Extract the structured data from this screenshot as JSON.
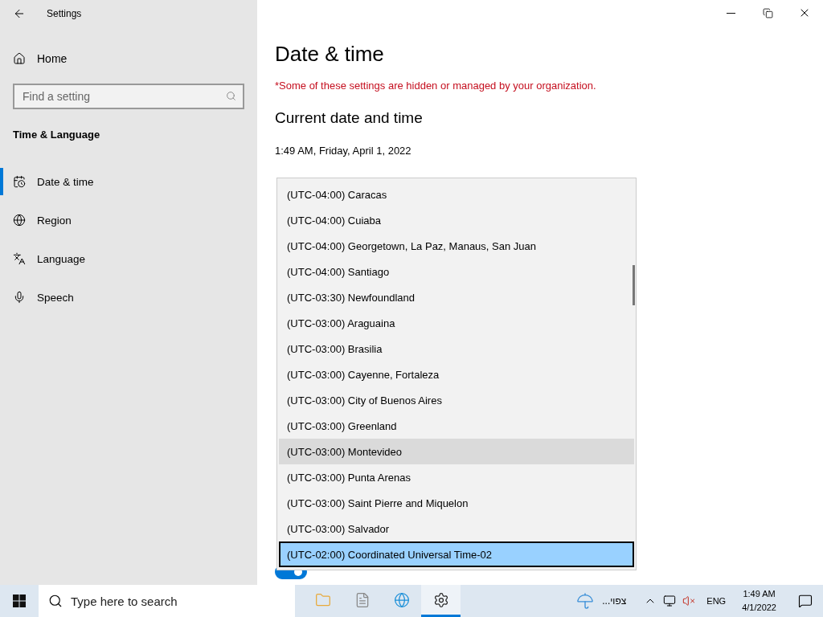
{
  "window": {
    "title": "Settings"
  },
  "sidebar": {
    "home": "Home",
    "search": {
      "placeholder": "Find a setting"
    },
    "section": "Time & Language",
    "items": [
      {
        "label": "Date & time",
        "selected": true,
        "kind": "calendar"
      },
      {
        "label": "Region",
        "selected": false,
        "kind": "globe"
      },
      {
        "label": "Language",
        "selected": false,
        "kind": "language"
      },
      {
        "label": "Speech",
        "selected": false,
        "kind": "mic"
      }
    ]
  },
  "page": {
    "title": "Date & time",
    "notice": "*Some of these settings are hidden or managed by your organization.",
    "heading": "Current date and time",
    "datetime": "1:49 AM, Friday, April 1, 2022",
    "toggle": {
      "on": true
    }
  },
  "timezone_list": [
    {
      "label": "(UTC-04:00) Caracas",
      "selected": false,
      "hovered": false
    },
    {
      "label": "(UTC-04:00) Cuiaba",
      "selected": false,
      "hovered": false
    },
    {
      "label": "(UTC-04:00) Georgetown, La Paz, Manaus, San Juan",
      "selected": false,
      "hovered": false
    },
    {
      "label": "(UTC-04:00) Santiago",
      "selected": false,
      "hovered": false
    },
    {
      "label": "(UTC-03:30) Newfoundland",
      "selected": false,
      "hovered": false
    },
    {
      "label": "(UTC-03:00) Araguaina",
      "selected": false,
      "hovered": false
    },
    {
      "label": "(UTC-03:00) Brasilia",
      "selected": false,
      "hovered": false
    },
    {
      "label": "(UTC-03:00) Cayenne, Fortaleza",
      "selected": false,
      "hovered": false
    },
    {
      "label": "(UTC-03:00) City of Buenos Aires",
      "selected": false,
      "hovered": false
    },
    {
      "label": "(UTC-03:00) Greenland",
      "selected": false,
      "hovered": false
    },
    {
      "label": "(UTC-03:00) Montevideo",
      "selected": false,
      "hovered": true
    },
    {
      "label": "(UTC-03:00) Punta Arenas",
      "selected": false,
      "hovered": false
    },
    {
      "label": "(UTC-03:00) Saint Pierre and Miquelon",
      "selected": false,
      "hovered": false
    },
    {
      "label": "(UTC-03:00) Salvador",
      "selected": false,
      "hovered": false
    },
    {
      "label": "(UTC-02:00) Coordinated Universal Time-02",
      "selected": true,
      "hovered": false
    }
  ],
  "taskbar": {
    "search": {
      "placeholder": "Type here to search"
    },
    "apps": [
      {
        "kind": "folder",
        "selected": false
      },
      {
        "kind": "document",
        "selected": false
      },
      {
        "kind": "browser",
        "selected": false
      },
      {
        "kind": "gear",
        "selected": true
      }
    ],
    "weather": "צפוי...",
    "language": "ENG",
    "time": "1:49 AM",
    "date": "4/1/2022"
  }
}
